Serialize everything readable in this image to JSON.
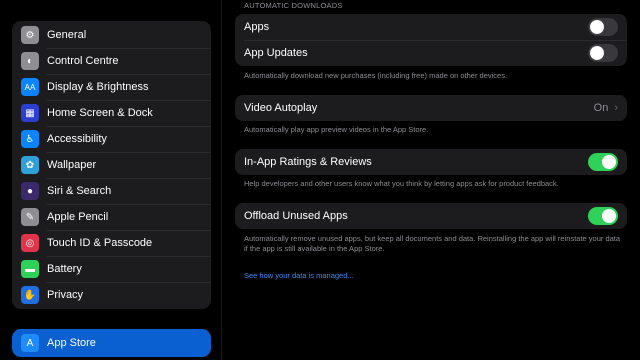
{
  "sidebar": {
    "items": [
      {
        "label": "General",
        "icon": "gear-icon",
        "color": "#8e8e93",
        "glyph": "⚙"
      },
      {
        "label": "Control Centre",
        "icon": "toggles-icon",
        "color": "#8e8e93",
        "glyph": "◐"
      },
      {
        "label": "Display & Brightness",
        "icon": "text-size-icon",
        "color": "#0a84ff",
        "glyph": "AA"
      },
      {
        "label": "Home Screen & Dock",
        "icon": "home-grid-icon",
        "color": "#2c3fd1",
        "glyph": "▦"
      },
      {
        "label": "Accessibility",
        "icon": "accessibility-icon",
        "color": "#0a84ff",
        "glyph": "♿"
      },
      {
        "label": "Wallpaper",
        "icon": "flower-icon",
        "color": "#30a0d8",
        "glyph": "✿"
      },
      {
        "label": "Siri & Search",
        "icon": "siri-icon",
        "color": "#3a2a6a",
        "glyph": "●"
      },
      {
        "label": "Apple Pencil",
        "icon": "pencil-icon",
        "color": "#8e8e93",
        "glyph": "✎"
      },
      {
        "label": "Touch ID & Passcode",
        "icon": "fingerprint-icon",
        "color": "#e0344a",
        "glyph": "◎"
      },
      {
        "label": "Battery",
        "icon": "battery-icon",
        "color": "#30d158",
        "glyph": "▬"
      },
      {
        "label": "Privacy",
        "icon": "hand-icon",
        "color": "#1f6fe0",
        "glyph": "✋"
      }
    ],
    "selected": {
      "label": "App Store",
      "icon": "app-store-icon",
      "color": "#1e8bff",
      "glyph": "A"
    }
  },
  "main": {
    "section_header": "AUTOMATIC DOWNLOADS",
    "downloads": {
      "apps_label": "Apps",
      "apps_on": false,
      "updates_label": "App Updates",
      "updates_on": false,
      "footnote": "Automatically download new purchases (including free) made on other devices."
    },
    "video": {
      "label": "Video Autoplay",
      "value": "On",
      "footnote": "Automatically play app preview videos in the App Store."
    },
    "ratings": {
      "label": "In-App Ratings & Reviews",
      "on": true,
      "footnote": "Help developers and other users know what you think by letting apps ask for product feedback."
    },
    "offload": {
      "label": "Offload Unused Apps",
      "on": true,
      "footnote": "Automatically remove unused apps, but keep all documents and data. Reinstalling the app will reinstate your data if the app is still available in the App Store."
    },
    "link": "See how your data is managed..."
  }
}
